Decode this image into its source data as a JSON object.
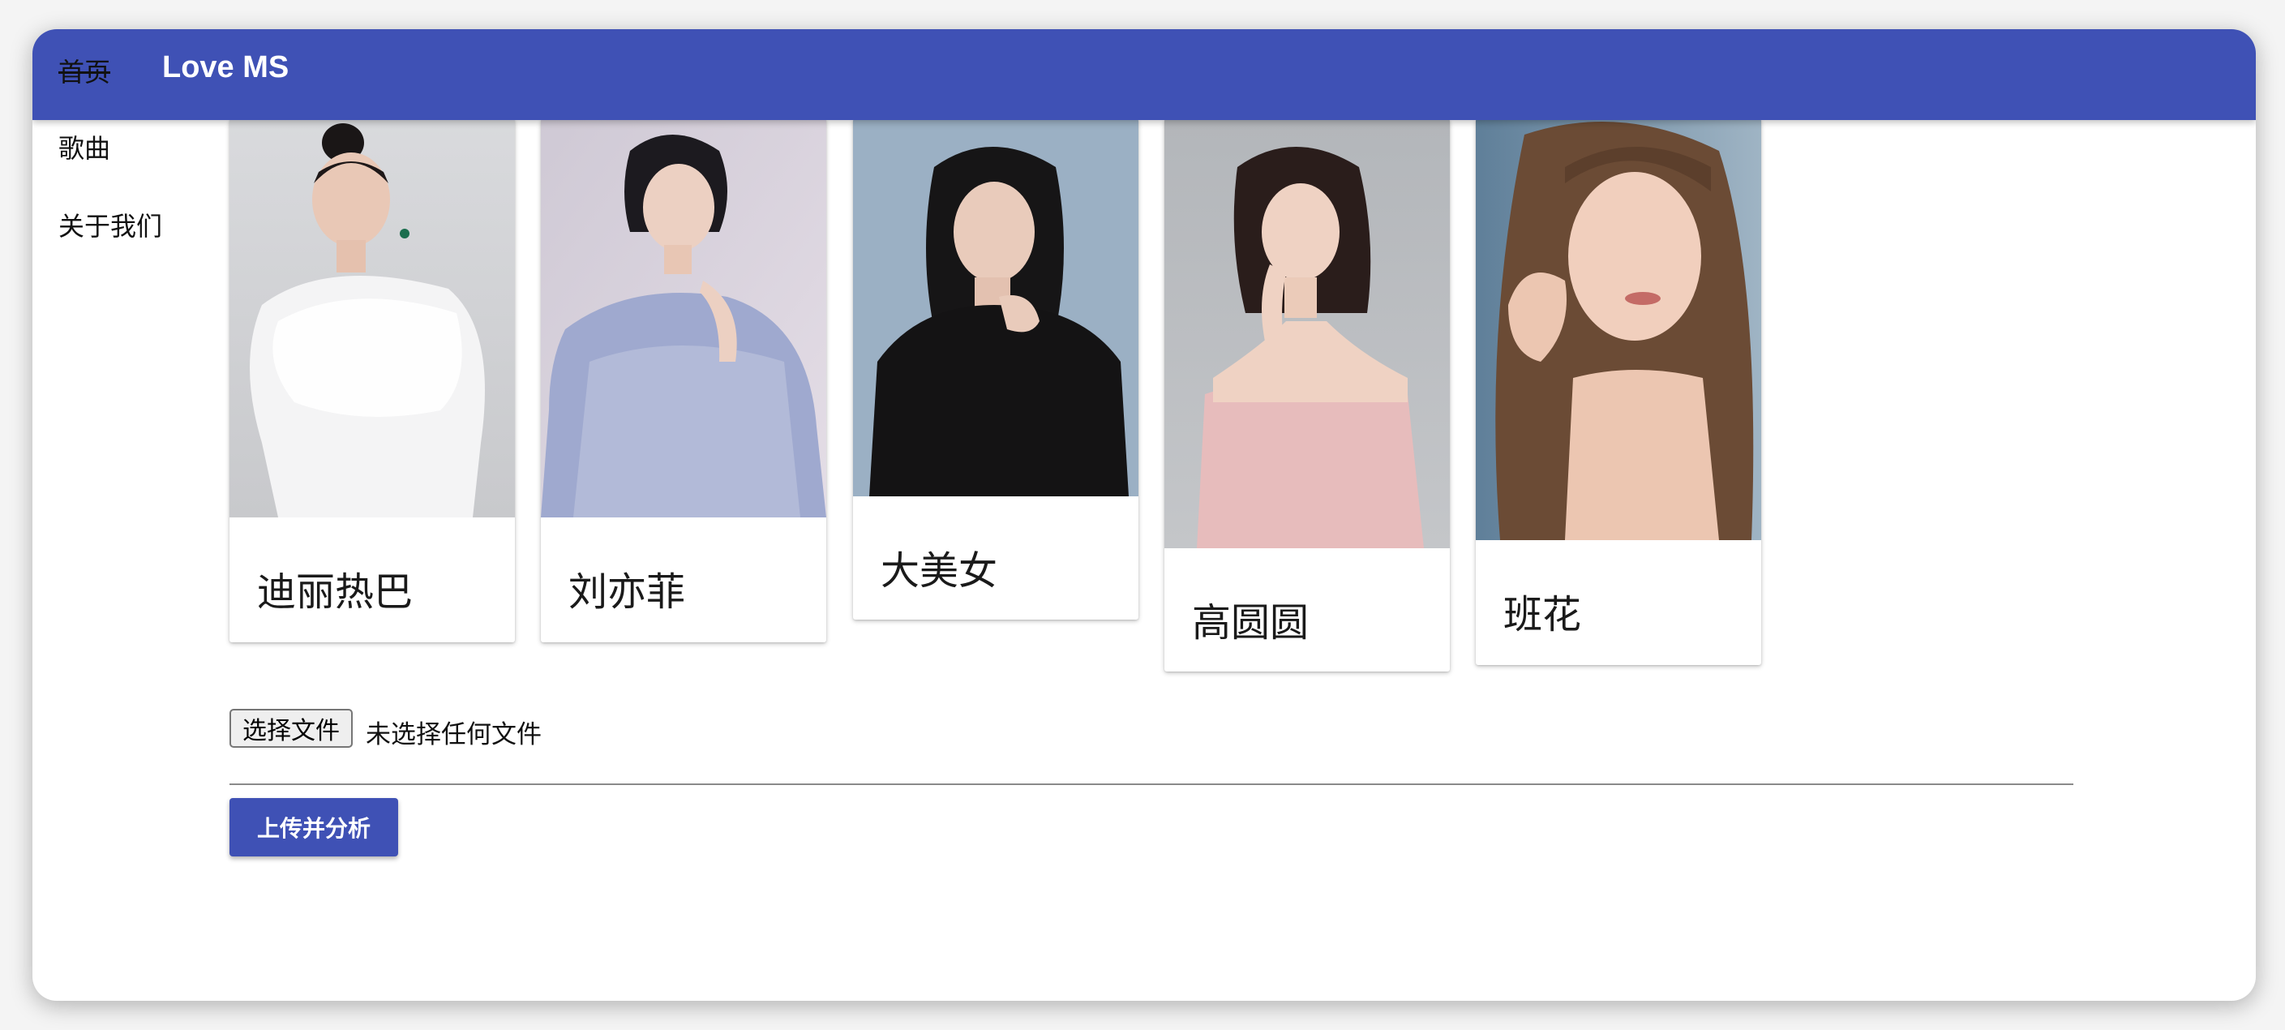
{
  "app": {
    "title": "Love MS"
  },
  "sidebar": {
    "items": [
      {
        "label": "首页"
      },
      {
        "label": "歌曲"
      },
      {
        "label": "关于我们"
      }
    ]
  },
  "cards": [
    {
      "name": "迪丽热巴"
    },
    {
      "name": "刘亦菲"
    },
    {
      "name": "大美女"
    },
    {
      "name": "高圆圆"
    },
    {
      "name": "班花"
    }
  ],
  "upload": {
    "choose_file_label": "选择文件",
    "no_file_text": "未选择任何文件",
    "submit_label": "上传并分析"
  },
  "colors": {
    "primary": "#3f51b5",
    "surface": "#ffffff"
  }
}
